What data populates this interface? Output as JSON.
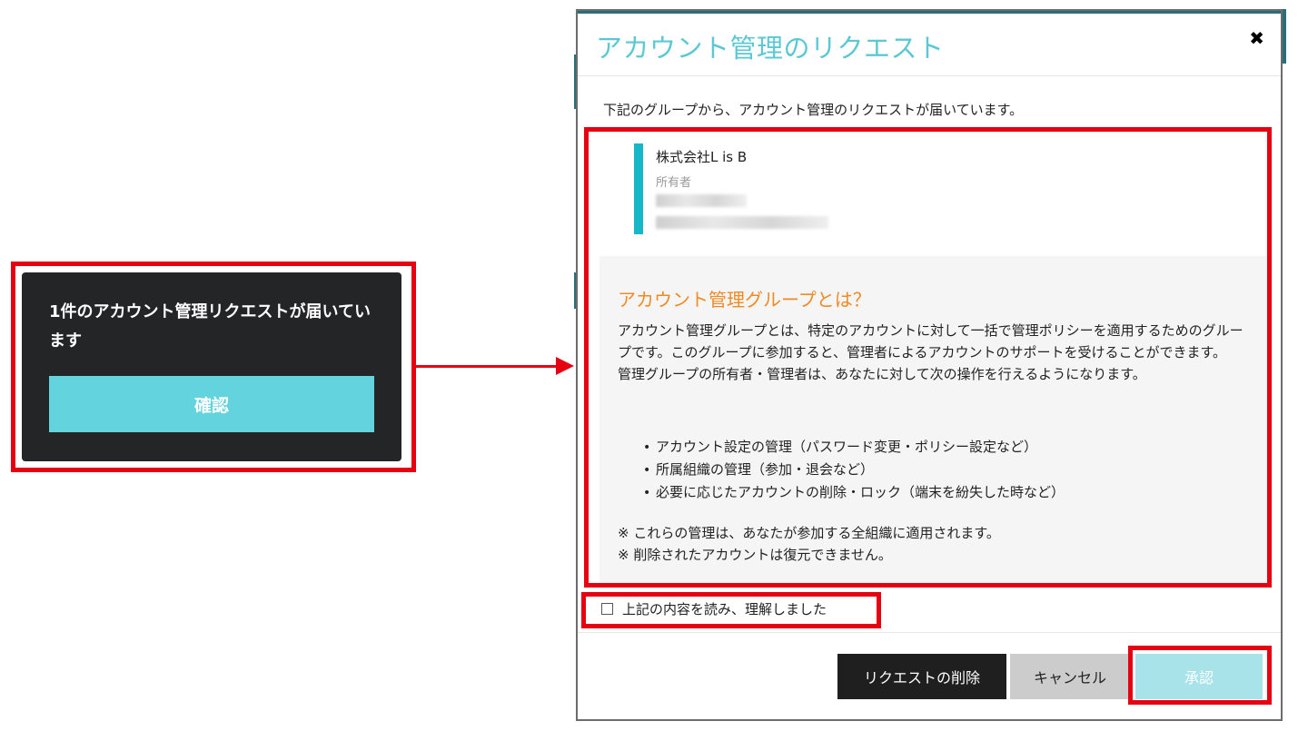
{
  "toast": {
    "message": "1件のアカウント管理リクエストが届いています",
    "confirm_label": "確認"
  },
  "modal": {
    "title": "アカウント管理のリクエスト",
    "close_icon": "close-icon",
    "intro": "下記のグループから、アカウント管理のリクエストが届いています。",
    "group": {
      "name": "株式会社L is B",
      "owner_label": "所有者"
    },
    "info": {
      "heading": "アカウント管理グループとは？",
      "body_1": "アカウント管理グループとは、特定のアカウントに対して一括で管理ポリシーを適用するためのグループです。このグループに参加すると、管理者によるアカウントのサポートを受けることができます。",
      "body_2": "管理グループの所有者・管理者は、あなたに対して次の操作を行えるようになります。",
      "items": [
        "アカウント設定の管理（パスワード変更・ポリシー設定など）",
        "所属組織の管理（参加・退会など）",
        "必要に応じたアカウントの削除・ロック（端末を紛失した時など）"
      ],
      "note_1": "※ これらの管理は、あなたが参加する全組織に適用されます。",
      "note_2": "※ 削除されたアカウントは復元できません。"
    },
    "agree_label": "上記の内容を読み、理解しました",
    "buttons": {
      "delete_request": "リクエストの削除",
      "cancel": "キャンセル",
      "approve": "承認"
    }
  },
  "colors": {
    "highlight": "#e60012",
    "accent": "#5cc8d4",
    "toast_bg": "#242527",
    "heading_orange": "#f08a24"
  }
}
